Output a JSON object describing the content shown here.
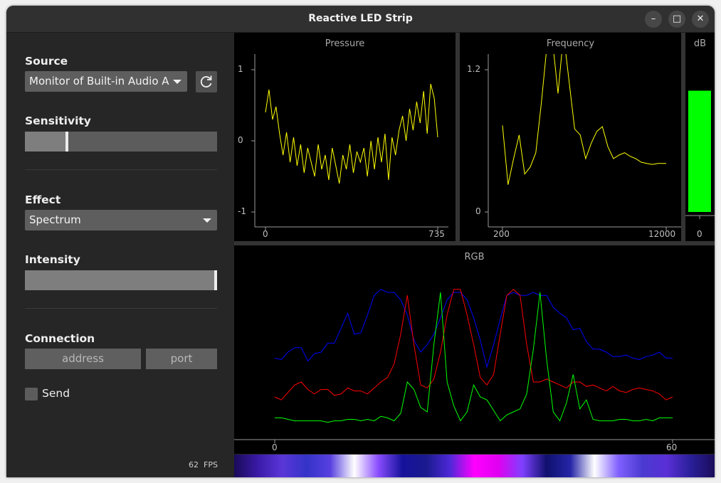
{
  "window": {
    "title": "Reactive LED Strip",
    "controls": {
      "minimize": "–",
      "maximize": "□",
      "close": "✕"
    }
  },
  "sidebar": {
    "source_label": "Source",
    "source_value": "Monitor of Built-in Audio A",
    "sensitivity_label": "Sensitivity",
    "sensitivity_level": 0.22,
    "effect_label": "Effect",
    "effect_value": "Spectrum",
    "intensity_label": "Intensity",
    "intensity_level": 1.0,
    "connection_label": "Connection",
    "address_placeholder": "address",
    "port_placeholder": "port",
    "send_label": "Send",
    "send_checked": false,
    "fps_value": "62",
    "fps_unit": "FPS"
  },
  "pressure": {
    "title": "Pressure",
    "y_ticks": [
      "1",
      "0",
      "-1"
    ],
    "x_ticks": [
      "0",
      "735"
    ]
  },
  "frequency": {
    "title": "Frequency",
    "y_ticks": [
      "1.2",
      "0"
    ],
    "x_ticks": [
      "200",
      "12000"
    ]
  },
  "db": {
    "title": "dB",
    "x_tick": "0",
    "level": 0.87,
    "color": "#00ff00"
  },
  "rgb": {
    "title": "RGB",
    "x_ticks": [
      "0",
      "60"
    ]
  },
  "chart_data": [
    {
      "type": "line",
      "title": "Pressure",
      "xlim": [
        0,
        735
      ],
      "ylim": [
        -1,
        1
      ],
      "series": [
        {
          "color": "#ffff00",
          "x": [
            0,
            15,
            30,
            45,
            60,
            75,
            90,
            105,
            120,
            135,
            150,
            165,
            180,
            195,
            210,
            225,
            240,
            255,
            270,
            285,
            300,
            315,
            330,
            345,
            360,
            375,
            390,
            405,
            420,
            435,
            450,
            465,
            480,
            495,
            510,
            525,
            540,
            555,
            570,
            585,
            600,
            615,
            630,
            645,
            660,
            675,
            690,
            705,
            720,
            735
          ],
          "values": [
            0.4,
            0.72,
            0.3,
            0.48,
            0.1,
            -0.2,
            0.12,
            -0.3,
            0.05,
            -0.35,
            -0.05,
            -0.45,
            -0.1,
            -0.3,
            -0.5,
            -0.05,
            -0.4,
            -0.2,
            -0.55,
            -0.1,
            -0.35,
            -0.6,
            -0.2,
            -0.4,
            -0.05,
            -0.45,
            -0.15,
            -0.3,
            -0.1,
            -0.5,
            0.0,
            -0.4,
            0.05,
            -0.3,
            0.1,
            -0.55,
            0.05,
            -0.2,
            0.15,
            0.35,
            0.0,
            0.45,
            0.15,
            0.55,
            0.25,
            0.7,
            0.1,
            0.8,
            0.6,
            0.05
          ]
        }
      ]
    },
    {
      "type": "line",
      "title": "Frequency",
      "xlim": [
        200,
        12000
      ],
      "ylim": [
        0,
        1.2
      ],
      "series": [
        {
          "color": "#ffff00",
          "x": [
            200,
            600,
            1000,
            1400,
            1800,
            2200,
            2600,
            3000,
            3400,
            3800,
            4200,
            4600,
            5000,
            5400,
            5800,
            6200,
            6600,
            7000,
            7400,
            7800,
            8200,
            8600,
            9000,
            9400,
            9800,
            10200,
            10600,
            11000,
            11400,
            11800,
            12000
          ],
          "values": [
            0.73,
            0.23,
            0.45,
            0.65,
            0.32,
            0.38,
            0.5,
            0.92,
            1.4,
            1.45,
            1.0,
            1.5,
            1.1,
            0.7,
            0.65,
            0.45,
            0.58,
            0.68,
            0.72,
            0.55,
            0.45,
            0.48,
            0.5,
            0.47,
            0.45,
            0.42,
            0.41,
            0.4,
            0.41,
            0.41,
            0.41
          ]
        }
      ]
    },
    {
      "type": "bar",
      "title": "dB",
      "categories": [
        "0"
      ],
      "values": [
        0.87
      ],
      "ylim": [
        0,
        1
      ]
    },
    {
      "type": "line",
      "title": "RGB",
      "xlim": [
        0,
        60
      ],
      "series": [
        {
          "color": "#0000ff",
          "values": [
            0.46,
            0.45,
            0.5,
            0.53,
            0.53,
            0.44,
            0.49,
            0.5,
            0.56,
            0.56,
            0.66,
            0.76,
            0.62,
            0.63,
            0.75,
            0.88,
            0.92,
            0.9,
            0.9,
            0.85,
            0.75,
            0.58,
            0.5,
            0.55,
            0.62,
            0.73,
            0.85,
            0.9,
            0.9,
            0.85,
            0.73,
            0.58,
            0.4,
            0.55,
            0.72,
            0.88,
            0.9,
            0.88,
            0.88,
            0.9,
            0.88,
            0.88,
            0.8,
            0.76,
            0.73,
            0.65,
            0.66,
            0.57,
            0.52,
            0.52,
            0.5,
            0.47,
            0.47,
            0.48,
            0.46,
            0.45,
            0.47,
            0.48,
            0.5,
            0.46,
            0.46
          ]
        },
        {
          "color": "#ff0000",
          "values": [
            0.2,
            0.18,
            0.23,
            0.28,
            0.3,
            0.25,
            0.22,
            0.25,
            0.25,
            0.21,
            0.22,
            0.26,
            0.24,
            0.24,
            0.22,
            0.26,
            0.3,
            0.33,
            0.42,
            0.62,
            0.88,
            0.55,
            0.28,
            0.26,
            0.32,
            0.5,
            0.75,
            0.92,
            0.92,
            0.75,
            0.55,
            0.33,
            0.28,
            0.35,
            0.62,
            0.88,
            0.92,
            0.88,
            0.55,
            0.3,
            0.3,
            0.32,
            0.3,
            0.28,
            0.26,
            0.3,
            0.3,
            0.27,
            0.28,
            0.26,
            0.24,
            0.27,
            0.24,
            0.23,
            0.25,
            0.26,
            0.25,
            0.24,
            0.22,
            0.18,
            0.2
          ]
        },
        {
          "color": "#00ff00",
          "values": [
            0.06,
            0.06,
            0.05,
            0.04,
            0.04,
            0.04,
            0.04,
            0.04,
            0.03,
            0.04,
            0.04,
            0.05,
            0.05,
            0.04,
            0.05,
            0.04,
            0.07,
            0.06,
            0.04,
            0.09,
            0.3,
            0.25,
            0.13,
            0.1,
            0.55,
            0.9,
            0.3,
            0.14,
            0.04,
            0.1,
            0.28,
            0.2,
            0.18,
            0.11,
            0.04,
            0.08,
            0.1,
            0.12,
            0.22,
            0.52,
            0.9,
            0.45,
            0.1,
            0.04,
            0.16,
            0.35,
            0.12,
            0.18,
            0.05,
            0.04,
            0.04,
            0.04,
            0.05,
            0.05,
            0.04,
            0.04,
            0.05,
            0.04,
            0.06,
            0.06,
            0.06
          ]
        }
      ]
    }
  ],
  "colors": {
    "accent_line": "#ffff00",
    "db_bar": "#00ff00",
    "led_strip": [
      "#1a0b58",
      "#3a1aa8",
      "#5a36d8",
      "#3433c8",
      "#5740e0",
      "#ffffff",
      "#8a4cff",
      "#16129c",
      "#1a1a8e",
      "#4f28d8",
      "#ff00ff",
      "#e000f0",
      "#7f40ff",
      "#10106e",
      "#2525a8",
      "#ffffff",
      "#8060ff",
      "#4a3ad0",
      "#5a2fd6",
      "#2a1f9a",
      "#1a0c5a"
    ]
  }
}
